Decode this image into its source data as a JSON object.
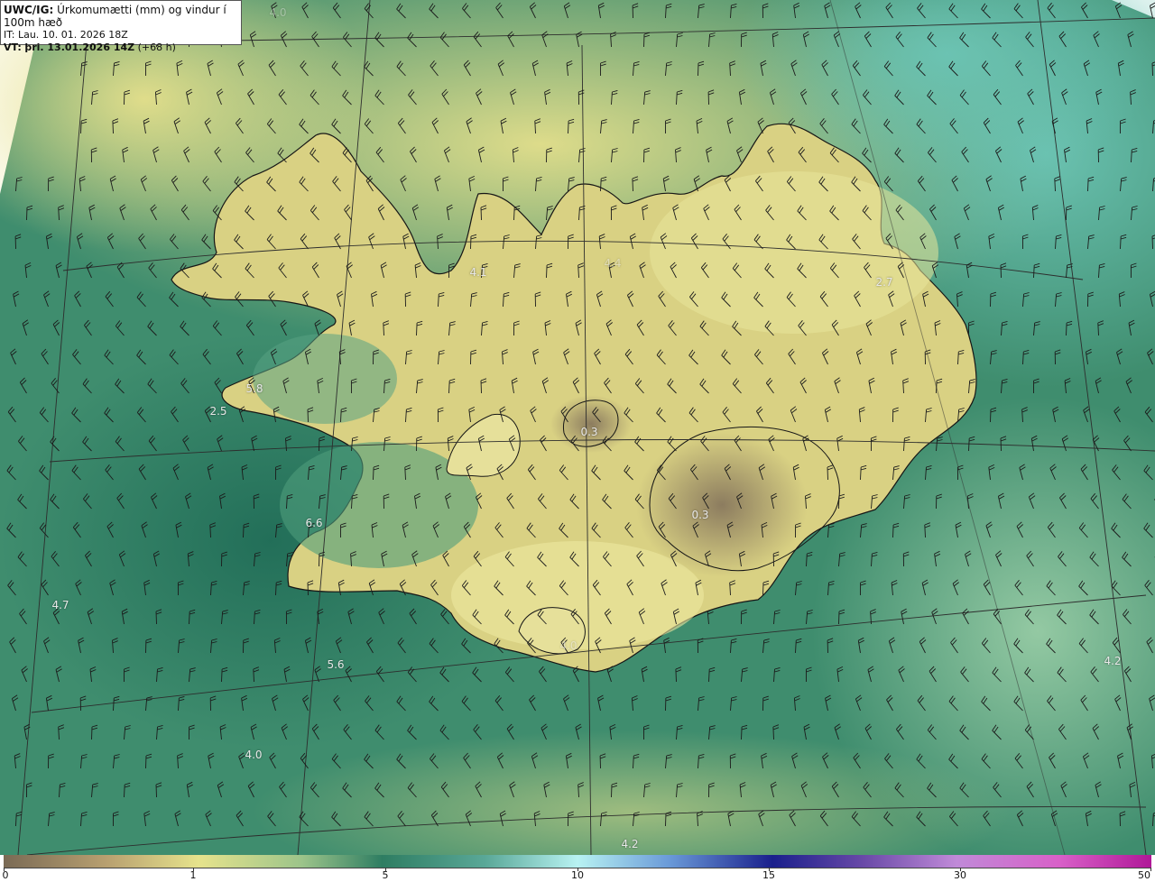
{
  "header": {
    "product": "UWC/IG:",
    "description": "Úrkomumætti (mm) og vindur í 100m hæð",
    "init_time": "IT: Lau. 10. 01. 2026 18Z",
    "valid_prefix": "VT:",
    "valid_time": "þri. 13.01.2026 14Z",
    "forecast_hour": "(+68 h)"
  },
  "value_labels": [
    {
      "text": "4.1"
    },
    {
      "text": "2.7"
    },
    {
      "text": "5.8"
    },
    {
      "text": "2.5"
    },
    {
      "text": "0.3"
    },
    {
      "text": "0.3"
    },
    {
      "text": "6.6"
    },
    {
      "text": "4.7"
    },
    {
      "text": "5.6"
    },
    {
      "text": "4.0"
    },
    {
      "text": "4.2"
    },
    {
      "text": "4.2"
    },
    {
      "text": "4.4"
    },
    {
      "text": "4.0"
    },
    {
      "text": "4.0"
    }
  ],
  "colorbar": {
    "ticks": [
      "0",
      "1",
      "5",
      "10",
      "15",
      "30",
      "50"
    ],
    "colors": {
      "brown": "#7a6a55",
      "tan": "#b8a070",
      "yellow": "#e6e38c",
      "green": "#2e7d62",
      "cyan": "#b8f2f2",
      "navy": "#1a1f8c",
      "magenta": "#d860c8"
    }
  },
  "map_colors": {
    "ocean_base": "#3c8a6c",
    "land_yellow": "#e2dd8a",
    "teal_ne": "#5cb8a8",
    "brown_glacier": "#8a7a60",
    "coastline": "#1a1a1a",
    "gridline": "#333333"
  }
}
